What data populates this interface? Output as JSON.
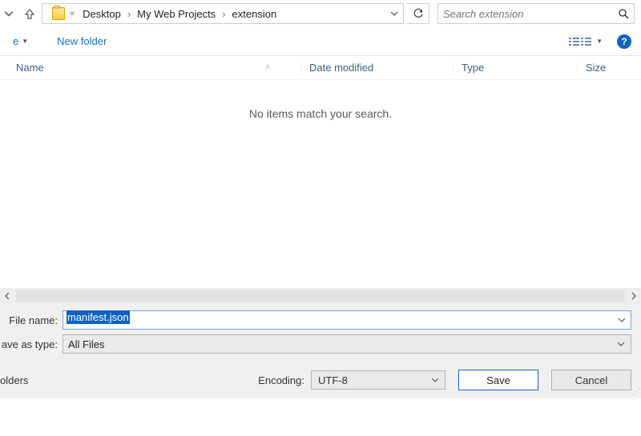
{
  "nav": {
    "breadcrumb": [
      "Desktop",
      "My Web Projects",
      "extension"
    ],
    "search_placeholder": "Search extension"
  },
  "toolbar": {
    "new_folder": "New folder"
  },
  "columns": {
    "name": "Name",
    "date": "Date modified",
    "type": "Type",
    "size": "Size"
  },
  "list": {
    "empty_message": "No items match your search."
  },
  "form": {
    "filename_label": "File name:",
    "filename_value": "manifest.json",
    "savetype_label": "ave as type:",
    "savetype_value": "All Files",
    "folders_link": "olders",
    "encoding_label": "Encoding:",
    "encoding_value": "UTF-8",
    "save": "Save",
    "cancel": "Cancel"
  }
}
